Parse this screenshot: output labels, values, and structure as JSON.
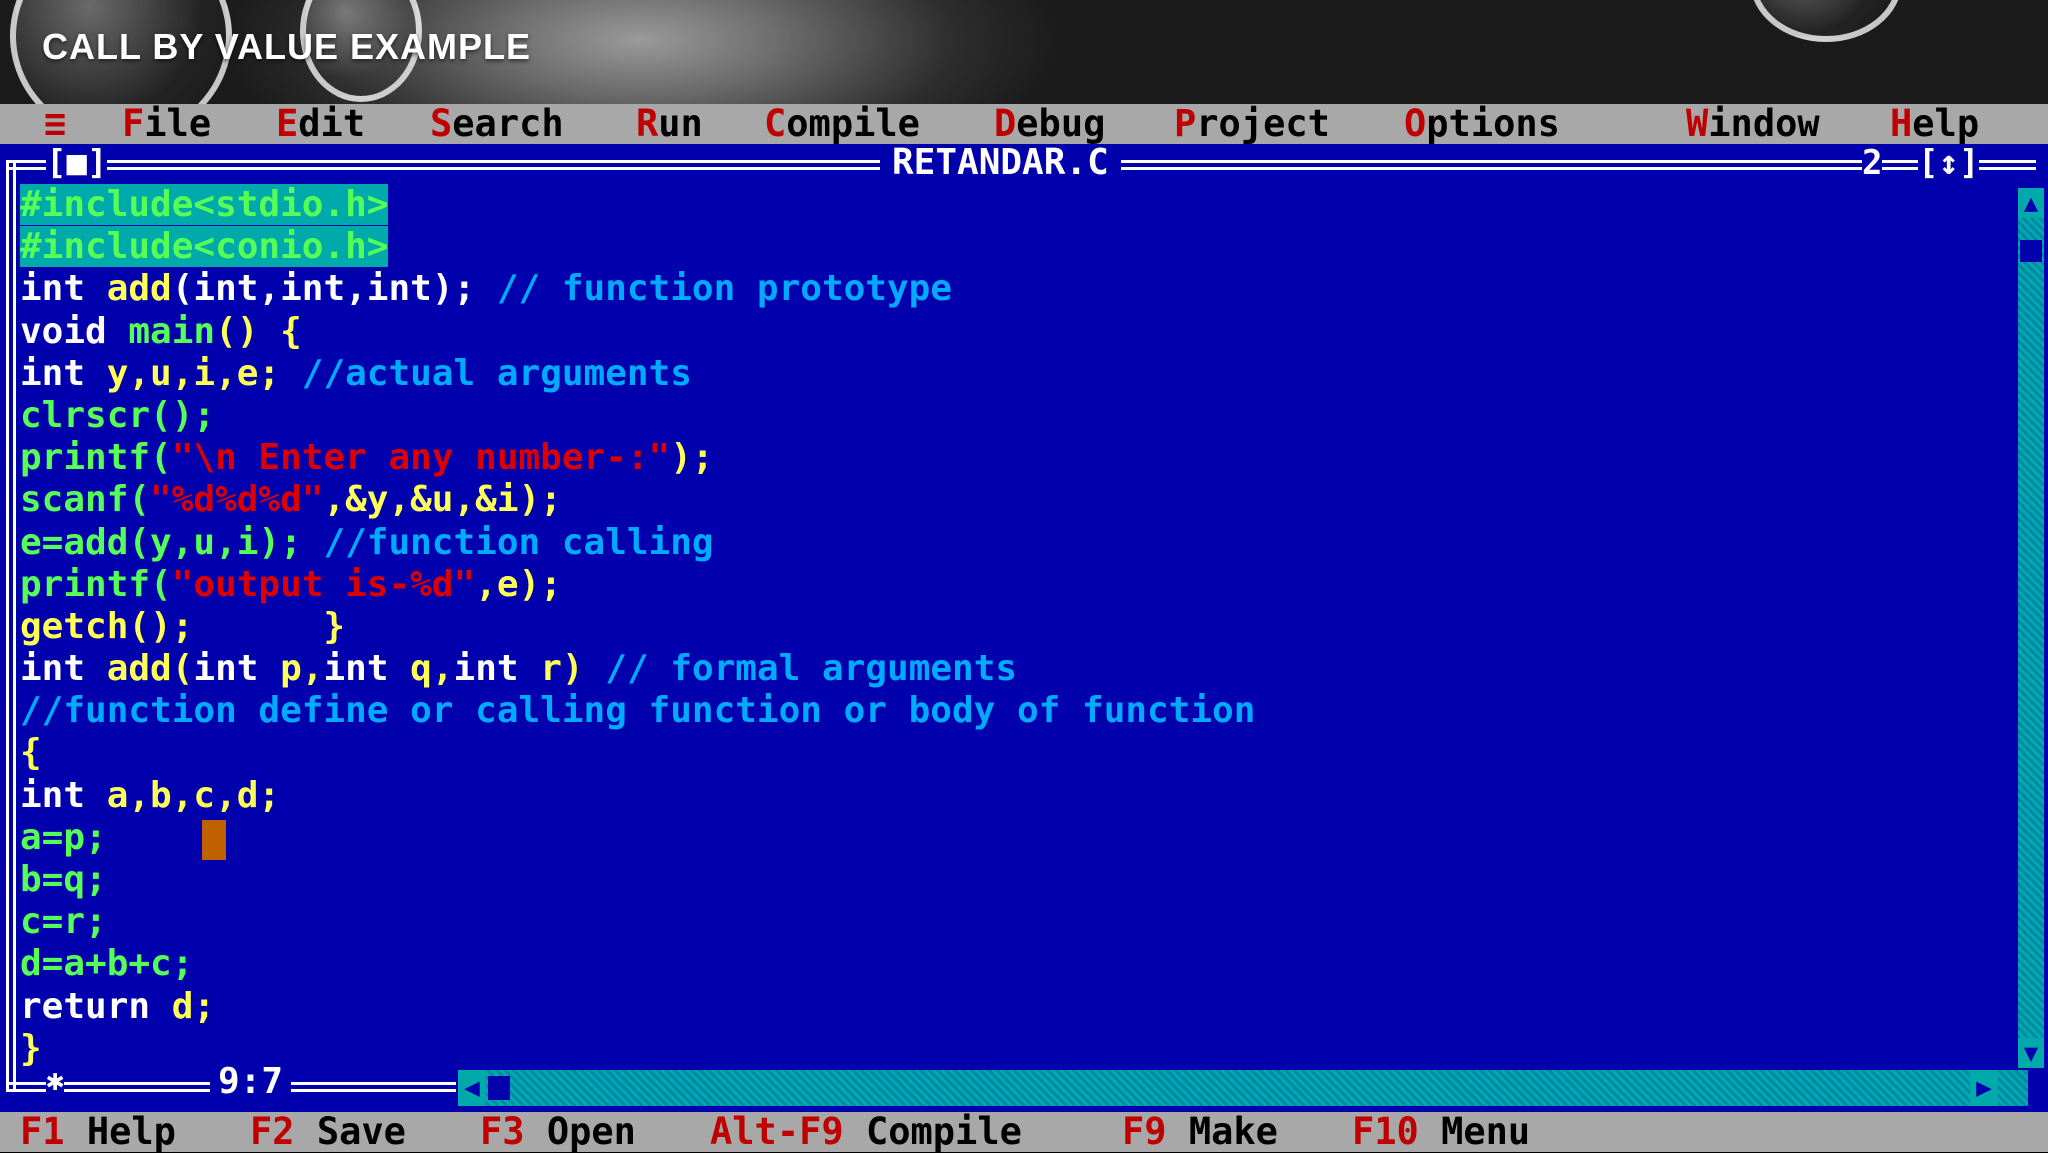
{
  "slide": {
    "title": "CALL BY VALUE EXAMPLE"
  },
  "menu": {
    "icon": "≡",
    "items": [
      {
        "hot": "F",
        "rest": "ile"
      },
      {
        "hot": "E",
        "rest": "dit"
      },
      {
        "hot": "S",
        "rest": "earch"
      },
      {
        "hot": "R",
        "rest": "un"
      },
      {
        "hot": "C",
        "rest": "ompile"
      },
      {
        "hot": "D",
        "rest": "ebug"
      },
      {
        "hot": "P",
        "rest": "roject"
      },
      {
        "hot": "O",
        "rest": "ptions"
      },
      {
        "hot": "W",
        "rest": "indow"
      },
      {
        "hot": "H",
        "rest": "elp"
      }
    ]
  },
  "editor": {
    "close_box": "[■]",
    "window_title": "RETANDAR.C",
    "window_number": "2",
    "zoom_box": "[↕]",
    "cursor_position": "9:7",
    "code_lines": [
      [
        {
          "t": "#include<stdio.h>",
          "c": "pp"
        }
      ],
      [
        {
          "t": "#include<conio.h>",
          "c": "pp"
        }
      ],
      [
        {
          "t": "int ",
          "c": "kw"
        },
        {
          "t": "add",
          "c": "id"
        },
        {
          "t": "(int,int,int); ",
          "c": "kw"
        },
        {
          "t": "// function prototype",
          "c": "cm"
        }
      ],
      [
        {
          "t": "void ",
          "c": "kw"
        },
        {
          "t": "main",
          "c": "gr"
        },
        {
          "t": "() {",
          "c": "id"
        }
      ],
      [
        {
          "t": "int ",
          "c": "kw"
        },
        {
          "t": "y,u,i,e; ",
          "c": "id"
        },
        {
          "t": "//actual arguments",
          "c": "cm"
        }
      ],
      [
        {
          "t": "clrscr();",
          "c": "gr"
        }
      ],
      [
        {
          "t": "printf(",
          "c": "gr"
        },
        {
          "t": "\"\\n Enter any number-:\"",
          "c": "st"
        },
        {
          "t": ");",
          "c": "id"
        }
      ],
      [
        {
          "t": "scanf(",
          "c": "gr"
        },
        {
          "t": "\"%d%d%d\"",
          "c": "st"
        },
        {
          "t": ",&y,&u,&i);",
          "c": "id"
        }
      ],
      [
        {
          "t": "e=add(y,u,i); ",
          "c": "gr"
        },
        {
          "t": "//function calling",
          "c": "cm"
        }
      ],
      [
        {
          "t": "printf(",
          "c": "gr"
        },
        {
          "t": "\"output is-%d\"",
          "c": "st"
        },
        {
          "t": ",e);",
          "c": "id"
        }
      ],
      [
        {
          "t": "getch();      }",
          "c": "id"
        }
      ],
      [
        {
          "t": "int ",
          "c": "kw"
        },
        {
          "t": "add(",
          "c": "id"
        },
        {
          "t": "int ",
          "c": "kw"
        },
        {
          "t": "p,",
          "c": "id"
        },
        {
          "t": "int ",
          "c": "kw"
        },
        {
          "t": "q,",
          "c": "id"
        },
        {
          "t": "int ",
          "c": "kw"
        },
        {
          "t": "r) ",
          "c": "id"
        },
        {
          "t": "// formal arguments",
          "c": "cm"
        }
      ],
      [
        {
          "t": "//function define or calling function or body of function",
          "c": "cm"
        }
      ],
      [
        {
          "t": "{",
          "c": "id"
        }
      ],
      [
        {
          "t": "int ",
          "c": "kw"
        },
        {
          "t": "a,b,c,d;",
          "c": "id"
        }
      ],
      [
        {
          "t": "a=p;",
          "c": "gr"
        }
      ],
      [
        {
          "t": "b=q;",
          "c": "gr"
        }
      ],
      [
        {
          "t": "c=r;",
          "c": "gr"
        }
      ],
      [
        {
          "t": "d=a+b+c;",
          "c": "gr"
        }
      ],
      [
        {
          "t": "return ",
          "c": "kw"
        },
        {
          "t": "d;",
          "c": "id"
        }
      ],
      [
        {
          "t": "}",
          "c": "id"
        }
      ]
    ]
  },
  "status_bar": [
    {
      "key": "F1",
      "label": "Help"
    },
    {
      "key": "F2",
      "label": "Save"
    },
    {
      "key": "F3",
      "label": "Open"
    },
    {
      "key": "Alt-F9",
      "label": "Compile"
    },
    {
      "key": "F9",
      "label": "Make"
    },
    {
      "key": "F10",
      "label": "Menu"
    }
  ],
  "colors": {
    "editor_bg": "#0000ac",
    "menu_bg": "#a8a8a8",
    "hotkey": "#c00000",
    "cursor": "#c06000"
  }
}
